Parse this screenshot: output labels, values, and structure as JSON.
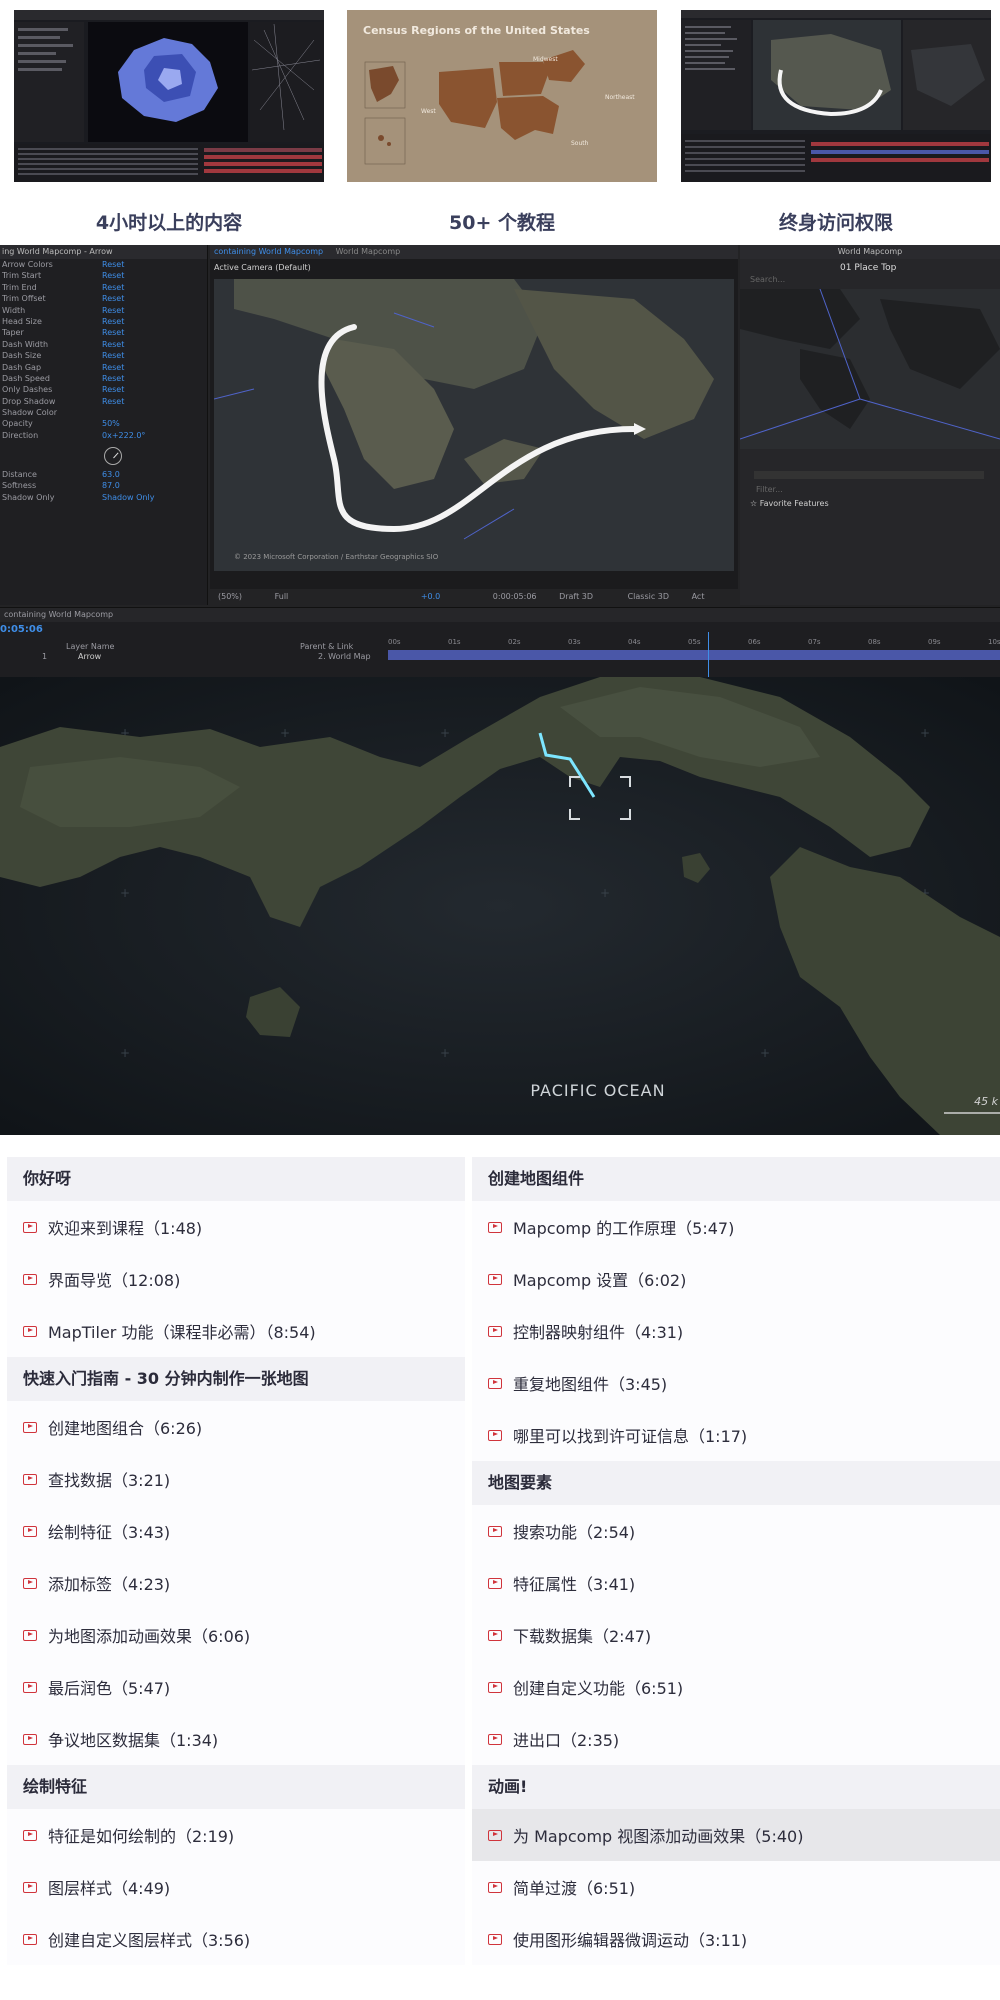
{
  "features": [
    {
      "label": "4小时以上的内容"
    },
    {
      "label": "50+ 个教程"
    },
    {
      "label": "终身访问权限"
    }
  ],
  "thumb_census": {
    "title": "Census Regions of the United States",
    "regions": [
      "Midwest",
      "Northeast",
      "West",
      "South"
    ]
  },
  "editor": {
    "effects_header": "ing World Mapcomp - Arrow",
    "properties": [
      {
        "name": "Arrow Colors",
        "value": "Reset"
      },
      {
        "name": "Trim Start",
        "value": "Reset"
      },
      {
        "name": "Trim End",
        "value": "Reset"
      },
      {
        "name": "Trim Offset",
        "value": "Reset"
      },
      {
        "name": "Width",
        "value": "Reset"
      },
      {
        "name": "Head Size",
        "value": "Reset"
      },
      {
        "name": "Taper",
        "value": "Reset"
      },
      {
        "name": "Dash Width",
        "value": "Reset"
      },
      {
        "name": "Dash Size",
        "value": "Reset"
      },
      {
        "name": "Dash Gap",
        "value": "Reset"
      },
      {
        "name": "Dash Speed",
        "value": "Reset"
      },
      {
        "name": "Only Dashes",
        "value": "Reset"
      },
      {
        "name": "Drop Shadow",
        "value": "Reset"
      },
      {
        "name": "Shadow Color",
        "value": ""
      },
      {
        "name": "Opacity",
        "value": "50%"
      },
      {
        "name": "Direction",
        "value": "0x+222.0°"
      }
    ],
    "extra_properties": [
      {
        "name": "Distance",
        "value": "63.0"
      },
      {
        "name": "Softness",
        "value": "87.0"
      },
      {
        "name": "Shadow Only",
        "value": "Shadow Only"
      }
    ],
    "viewer_tab_active": "containing World Mapcomp",
    "viewer_tab_other": "World Mapcomp",
    "camera_label": "Active Camera (Default)",
    "copyright": "© 2023 Microsoft Corporation / Earthstar Geographics  SIO",
    "toolbar": {
      "zoom": "(50%)",
      "resolution": "Full",
      "exposure": "+0.0",
      "time": "0:00:05:06",
      "renderer": "Draft 3D",
      "mode": "Classic 3D",
      "view": "Act"
    },
    "right_panel_title": "World Mapcomp",
    "place_select": "01 Place Top",
    "search_placeholder": "Search...",
    "filter_placeholder": "Filter...",
    "favorite_features": "Favorite Features",
    "timeline_title": "containing World Mapcomp",
    "timecode": "0:05:06",
    "layer_col": "Layer Name",
    "parent_col": "Parent & Link",
    "layer_index": "1",
    "layer_name": "Arrow",
    "layer_parent": "2. World Map",
    "ruler": [
      "00s",
      "01s",
      "02s",
      "03s",
      "04s",
      "05s",
      "06s",
      "07s",
      "08s",
      "09s",
      "10s"
    ]
  },
  "bigmap": {
    "ocean_label": "PACIFIC OCEAN",
    "scale_label": "45 k"
  },
  "curriculum": {
    "left": [
      {
        "title": "你好呀",
        "lessons": [
          "欢迎来到课程（1:48)",
          "界面导览（12:08)",
          "MapTiler 功能（课程非必需）（8:54)"
        ]
      },
      {
        "title": "快速入门指南 - 30 分钟内制作一张地图",
        "lessons": [
          "创建地图组合（6:26)",
          "查找数据（3:21)",
          "绘制特征（3:43)",
          "添加标签（4:23)",
          "为地图添加动画效果（6:06)",
          "最后润色（5:47)",
          "争议地区数据集（1:34)"
        ]
      },
      {
        "title": "绘制特征",
        "lessons": [
          "特征是如何绘制的（2:19)",
          "图层样式（4:49)",
          "创建自定义图层样式（3:56)"
        ]
      }
    ],
    "right": [
      {
        "title": "创建地图组件",
        "lessons": [
          "Mapcomp 的工作原理（5:47)",
          "Mapcomp 设置（6:02)",
          "控制器映射组件（4:31)",
          "重复地图组件（3:45)",
          "哪里可以找到许可证信息（1:17)"
        ]
      },
      {
        "title": "地图要素",
        "lessons": [
          "搜索功能（2:54)",
          "特征属性（3:41)",
          "下载数据集（2:47)",
          "创建自定义功能（6:51)",
          "进出口（2:35)"
        ]
      },
      {
        "title": "动画!",
        "lessons": [
          "为 Mapcomp 视图添加动画效果（5:40)",
          "简单过渡（6:51)",
          "使用图形编辑器微调运动（3:11)"
        ]
      }
    ]
  },
  "colors": {
    "accent": "#3f8ee8",
    "play_icon": "#d0343c",
    "section_bg": "#f1f1f5",
    "highlight_bg": "#e7e7ea"
  }
}
